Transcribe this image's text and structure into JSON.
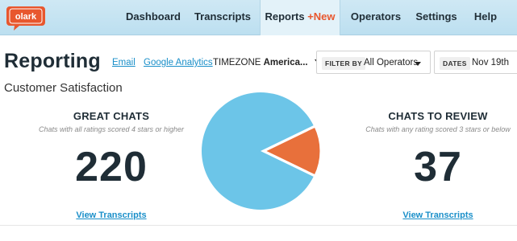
{
  "nav": {
    "logo_text": "olark",
    "items": [
      {
        "label": "Dashboard"
      },
      {
        "label": "Transcripts"
      },
      {
        "label": "Reports",
        "badge": "+New"
      },
      {
        "label": "Operators"
      },
      {
        "label": "Settings"
      },
      {
        "label": "Help"
      }
    ]
  },
  "reporting": {
    "title": "Reporting",
    "email_link": "Email",
    "analytics_link": "Google Analytics",
    "timezone_label": "TIMEZONE",
    "timezone_value": "America...",
    "filter_label": "FILTER BY",
    "filter_value": "All Operators",
    "dates_label": "DATES",
    "dates_value": "Nov 19th"
  },
  "section": {
    "title": "Customer Satisfaction"
  },
  "great": {
    "heading": "GREAT CHATS",
    "subtitle": "Chats with all ratings scored 4 stars or higher",
    "count": "220",
    "link": "View Transcripts"
  },
  "review": {
    "heading": "CHATS TO REVIEW",
    "subtitle": "Chats with any rating scored 3 stars or below",
    "count": "37",
    "link": "View Transcripts"
  },
  "chart_data": {
    "type": "pie",
    "slices": [
      {
        "label": "GREAT CHATS",
        "value": 220,
        "color": "#6cc5e8"
      },
      {
        "label": "CHATS TO REVIEW",
        "value": 37,
        "color": "#e8703b"
      }
    ]
  },
  "colors": {
    "nav_bg": "#c6e4f3",
    "link": "#1a8fc9",
    "accent": "#e8572e",
    "great": "#6cc5e8",
    "review": "#e8703b"
  }
}
